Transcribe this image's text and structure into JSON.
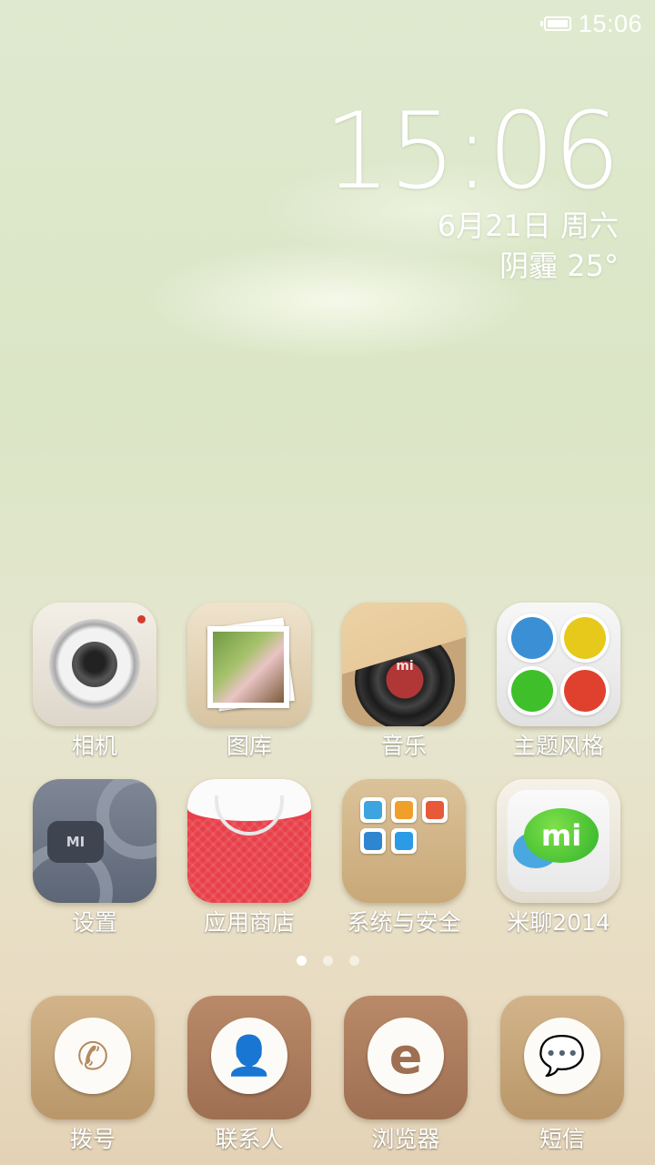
{
  "status_bar": {
    "time": "15:06",
    "battery_icon": "battery-icon"
  },
  "clock_widget": {
    "time": "15:06",
    "date": "6月21日 周六",
    "weather": "阴霾 25°"
  },
  "apps_row1": [
    {
      "label": "相机",
      "icon": "camera-icon"
    },
    {
      "label": "图库",
      "icon": "gallery-icon"
    },
    {
      "label": "音乐",
      "icon": "music-icon",
      "logo": "mi"
    },
    {
      "label": "主题风格",
      "icon": "theme-icon"
    }
  ],
  "apps_row2": [
    {
      "label": "设置",
      "icon": "settings-icon",
      "logo": "MI"
    },
    {
      "label": "应用商店",
      "icon": "app-store-icon"
    },
    {
      "label": "系统与安全",
      "icon": "folder-icon"
    },
    {
      "label": "米聊2014",
      "icon": "mitalk-icon",
      "logo": "mi"
    }
  ],
  "page_indicator": {
    "count": 3,
    "active_index": 0
  },
  "dock": [
    {
      "label": "拨号",
      "icon": "phone-icon",
      "glyph": "✆"
    },
    {
      "label": "联系人",
      "icon": "contacts-icon",
      "glyph": "👤"
    },
    {
      "label": "浏览器",
      "icon": "browser-icon",
      "glyph": "e"
    },
    {
      "label": "短信",
      "icon": "messages-icon",
      "glyph": "💬"
    }
  ],
  "colors": {
    "paint_blue": "#3b8fd4",
    "paint_yellow": "#e6c91a",
    "paint_green": "#3fbf2a",
    "paint_red": "#e0412e"
  }
}
